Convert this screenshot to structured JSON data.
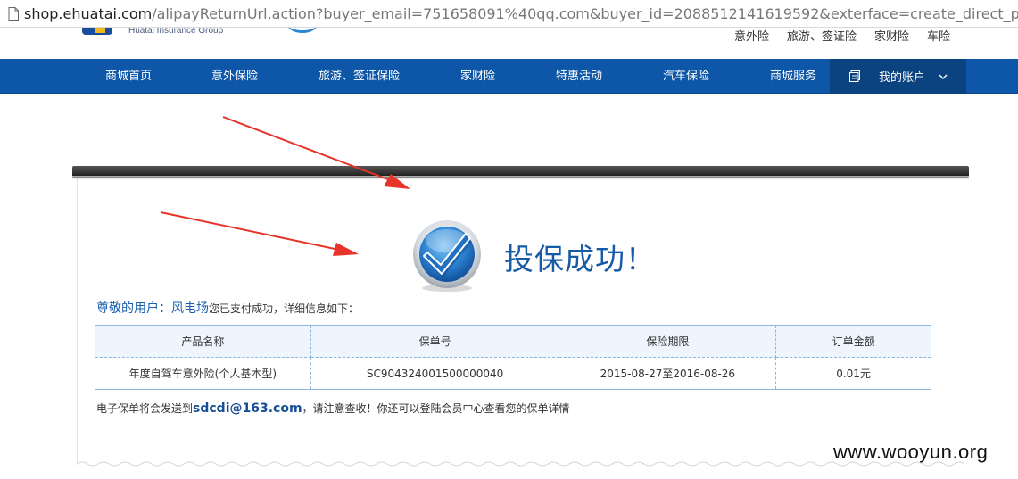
{
  "browser": {
    "url_host": "shop.ehuatai.com",
    "url_rest": "/alipayReturnUrl.action?buyer_email=751658091%40qq.com&buyer_id=2088512141619592&exterface=create_direct_pay_by_u"
  },
  "header": {
    "logo_subtext": "Huatai Insurance Group",
    "top_links": [
      "意外险",
      "旅游、签证险",
      "家财险",
      "车险"
    ]
  },
  "nav": {
    "items": [
      "商城首页",
      "意外保险",
      "旅游、签证保险",
      "家财险",
      "特惠活动",
      "汽车保险",
      "商城服务"
    ],
    "account_label": "我的账户"
  },
  "result": {
    "title": "投保成功！",
    "greeting_prefix": "尊敬的用户：",
    "username": "风电场",
    "greeting_suffix": "您已支付成功，详细信息如下："
  },
  "order_table": {
    "headers": [
      "产品名称",
      "保单号",
      "保险期限",
      "订单金额"
    ],
    "rows": [
      [
        "年度自驾车意外险(个人基本型)",
        "SC904324001500000040",
        "2015-08-27至2016-08-26",
        "0.01元"
      ]
    ]
  },
  "notice": {
    "prefix": "电子保单将会发送到",
    "email": "sdcdi@163.com",
    "suffix": "，请注意查收！你还可以登陆会员中心查看您的保单详情"
  },
  "watermark": "www.wooyun.org",
  "colors": {
    "nav_bg": "#0e56a7",
    "account_bg": "#0a437f",
    "accent_text": "#175aa5",
    "table_header_bg": "#eef5fc",
    "arrow_red": "#e8332a"
  }
}
